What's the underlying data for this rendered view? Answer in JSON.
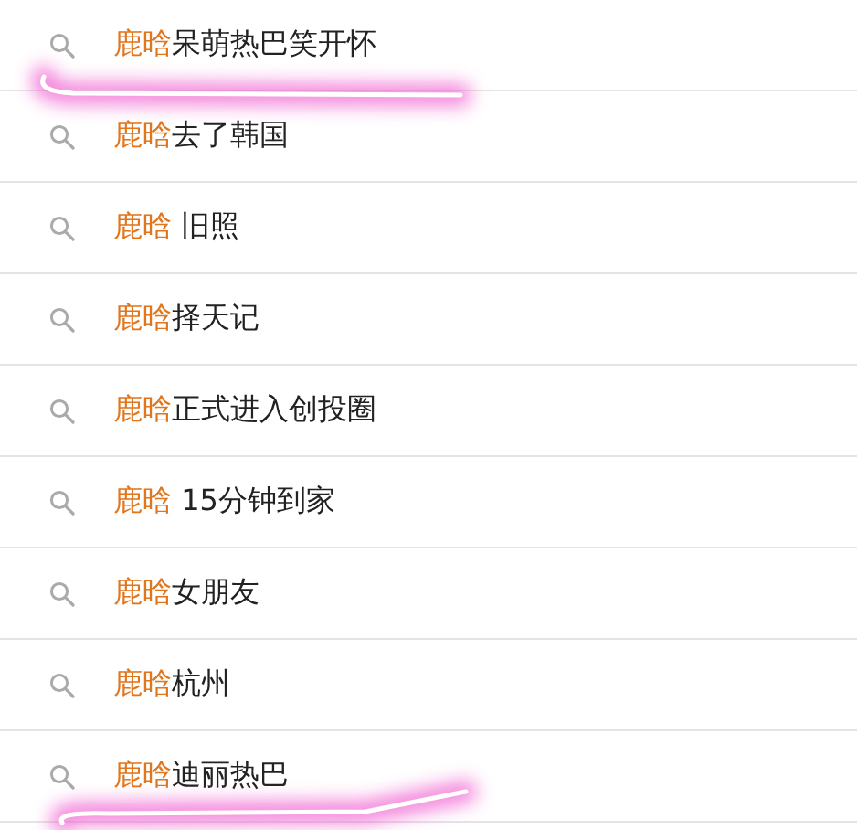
{
  "suggestions": [
    {
      "match": "鹿晗",
      "rest": "呆萌热巴笑开怀"
    },
    {
      "match": "鹿晗",
      "rest": "去了韩国"
    },
    {
      "match": "鹿晗",
      "rest": " 旧照"
    },
    {
      "match": "鹿晗",
      "rest": "择天记"
    },
    {
      "match": "鹿晗",
      "rest": "正式进入创投圈"
    },
    {
      "match": "鹿晗",
      "rest": " 15分钟到家"
    },
    {
      "match": "鹿晗",
      "rest": "女朋友"
    },
    {
      "match": "鹿晗",
      "rest": "杭州"
    },
    {
      "match": "鹿晗",
      "rest": "迪丽热巴"
    }
  ]
}
